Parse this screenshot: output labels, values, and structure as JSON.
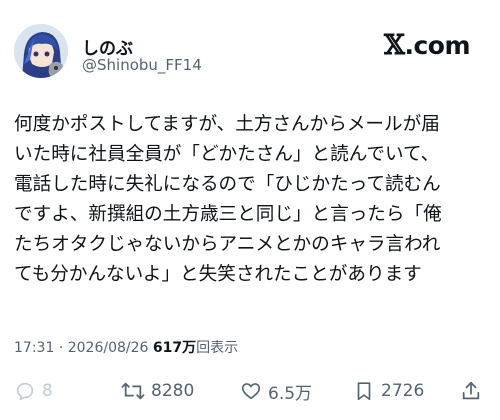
{
  "author": {
    "name": "しのぶ",
    "handle": "@Shinobu_FF14"
  },
  "brand": {
    "logo": "𝕏",
    "suffix": ".com"
  },
  "post": {
    "lines": [
      "何度かポストしてますが、土方さんからメールが届",
      "いた時に社員全員が「どかたさん」と読んでいて、",
      "電話した時に失礼になるので「ひじかたって読むん",
      "ですよ、新撰組の土方歳三と同じ」と言ったら「俺",
      "たちオタクじゃないからアニメとかのキャラ言われ",
      "ても分かんないよ」と失笑されたことがあります"
    ]
  },
  "meta": {
    "time": "17:31",
    "separator": " · ",
    "date": "2026/08/26",
    "views_count": "617万",
    "views_label": "回表示"
  },
  "actions": {
    "reply_count": "8",
    "repost_count": "8280",
    "like_count": "6.5万",
    "bookmark_count": "2726"
  },
  "colors": {
    "text": "#0f1419",
    "secondary": "#536471",
    "disabled": "#c4ccd3"
  },
  "icons": [
    "avatar-illustration",
    "reply-icon",
    "repost-icon",
    "like-icon",
    "bookmark-icon",
    "share-icon"
  ]
}
